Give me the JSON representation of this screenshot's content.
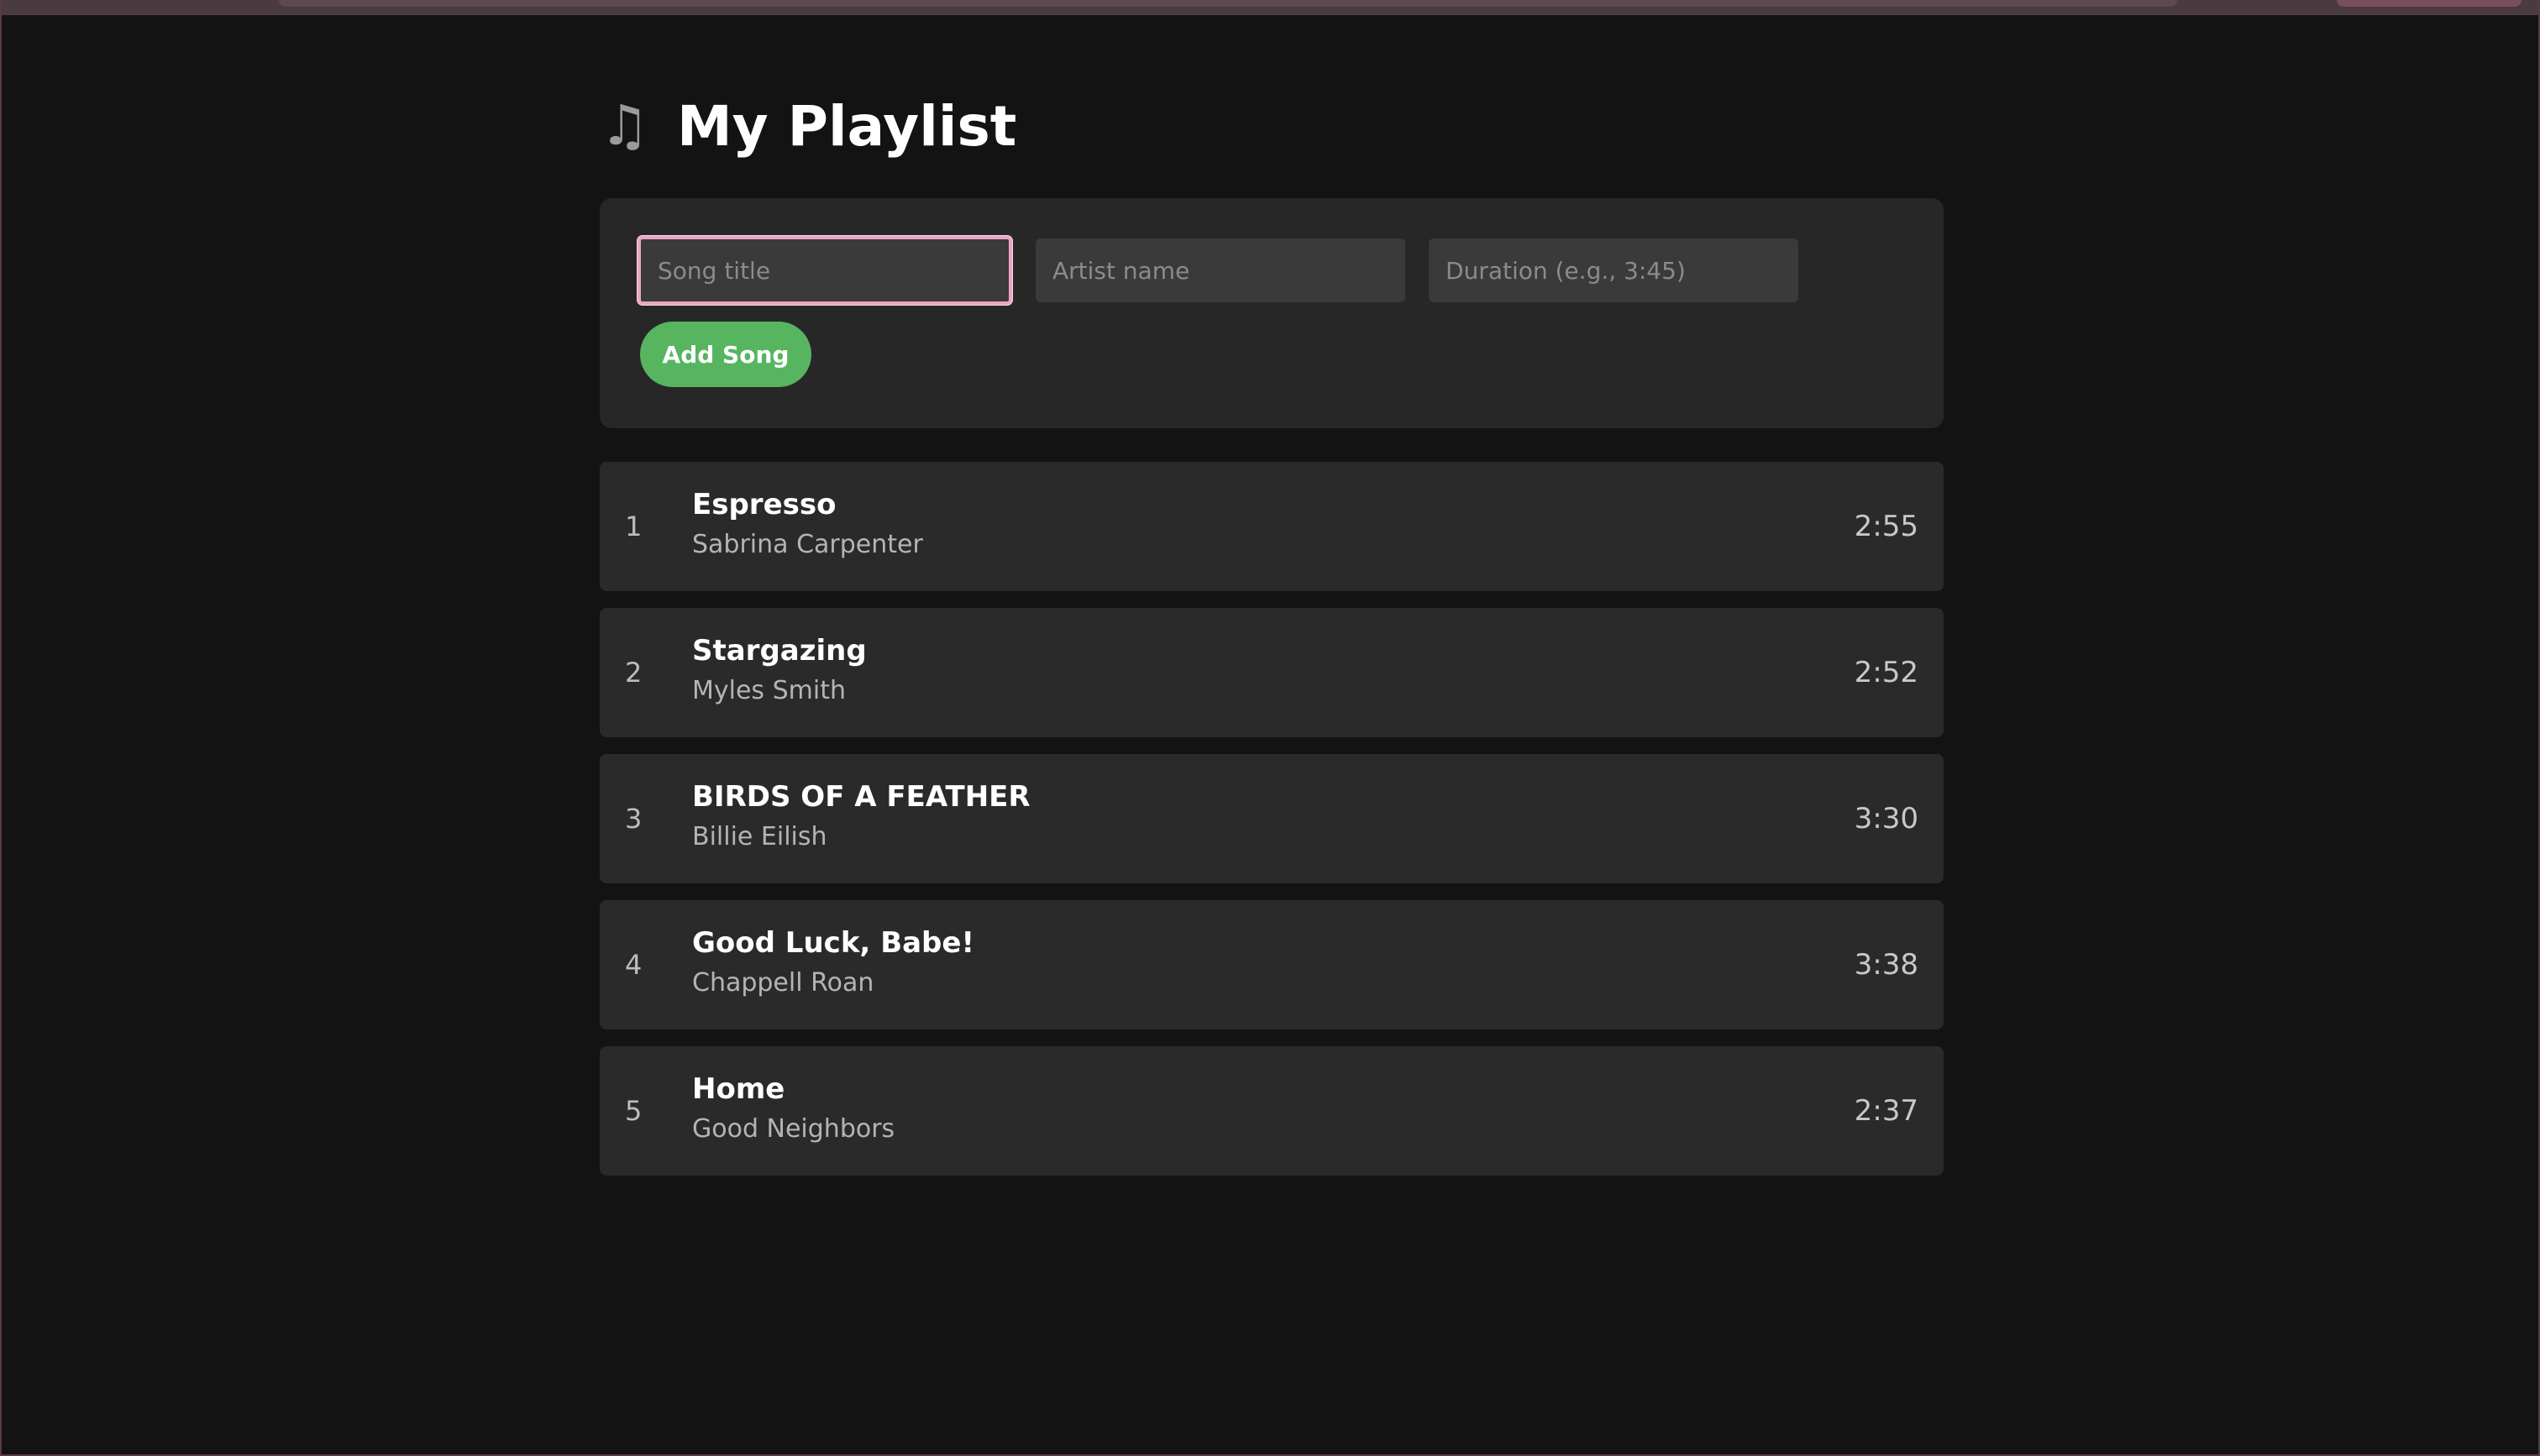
{
  "page": {
    "icon": "musical-notes-icon",
    "icon_glyph": "♫",
    "title": "My Playlist"
  },
  "form": {
    "title_placeholder": "Song title",
    "artist_placeholder": "Artist name",
    "duration_placeholder": "Duration (e.g., 3:45)",
    "title_value": "",
    "artist_value": "",
    "duration_value": "",
    "add_label": "Add Song"
  },
  "songs": [
    {
      "number": "1",
      "title": "Espresso",
      "artist": "Sabrina Carpenter",
      "duration": "2:55"
    },
    {
      "number": "2",
      "title": "Stargazing",
      "artist": "Myles Smith",
      "duration": "2:52"
    },
    {
      "number": "3",
      "title": "BIRDS OF A FEATHER",
      "artist": "Billie Eilish",
      "duration": "3:30"
    },
    {
      "number": "4",
      "title": "Good Luck, Babe!",
      "artist": "Chappell Roan",
      "duration": "3:38"
    },
    {
      "number": "5",
      "title": "Home",
      "artist": "Good Neighbors",
      "duration": "2:37"
    }
  ],
  "colors": {
    "background": "#131313",
    "panel": "#272727",
    "row": "#2a2a2a",
    "accent_button": "#57b560",
    "focus_ring": "#e9a6c4"
  }
}
